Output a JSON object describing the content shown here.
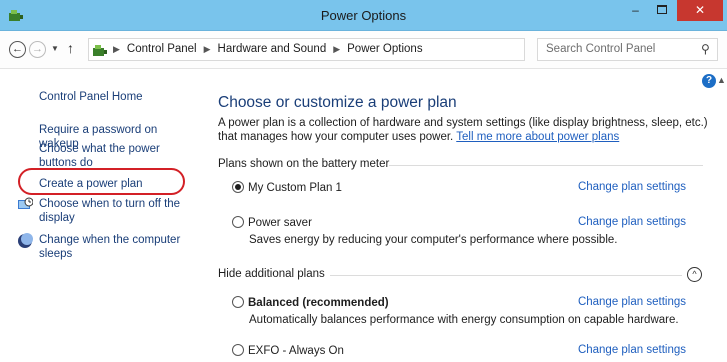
{
  "window": {
    "title": "Power Options"
  },
  "address": {
    "crumbs": [
      "Control Panel",
      "Hardware and Sound",
      "Power Options"
    ]
  },
  "search": {
    "placeholder": "Search Control Panel"
  },
  "sidebar": {
    "home": "Control Panel Home",
    "links": [
      "Require a password on wakeup",
      "Choose what the power buttons do",
      "Create a power plan",
      "Choose when to turn off the display",
      "Change when the computer sleeps"
    ]
  },
  "main": {
    "heading": "Choose or customize a power plan",
    "intro": "A power plan is a collection of hardware and system settings (like display brightness, sleep, etc.) that manages how your computer uses power.",
    "intro_link": "Tell me more about power plans",
    "section_battery": "Plans shown on the battery meter",
    "section_hidden": "Hide additional plans",
    "change_label": "Change plan settings",
    "plans": [
      {
        "name": "My Custom Plan 1",
        "desc": "",
        "selected": true
      },
      {
        "name": "Power saver",
        "desc": "Saves energy by reducing your computer's performance where possible.",
        "selected": false
      },
      {
        "name": "Balanced (recommended)",
        "desc": "Automatically balances performance with energy consumption on capable hardware.",
        "selected": false
      },
      {
        "name": "EXFO - Always On",
        "desc": "",
        "selected": false
      }
    ]
  },
  "colors": {
    "titlebar": "#79c4ec",
    "close_button": "#c7372f",
    "link": "#1f5fbf",
    "nav_link": "#1a3e78",
    "highlight": "#d32026"
  },
  "icons": [
    "power-options-icon",
    "back-arrow-icon",
    "forward-arrow-icon",
    "up-arrow-icon",
    "refresh-icon",
    "search-icon",
    "help-icon",
    "monitor-clock-icon",
    "moon-icon",
    "chevron-up-icon"
  ]
}
